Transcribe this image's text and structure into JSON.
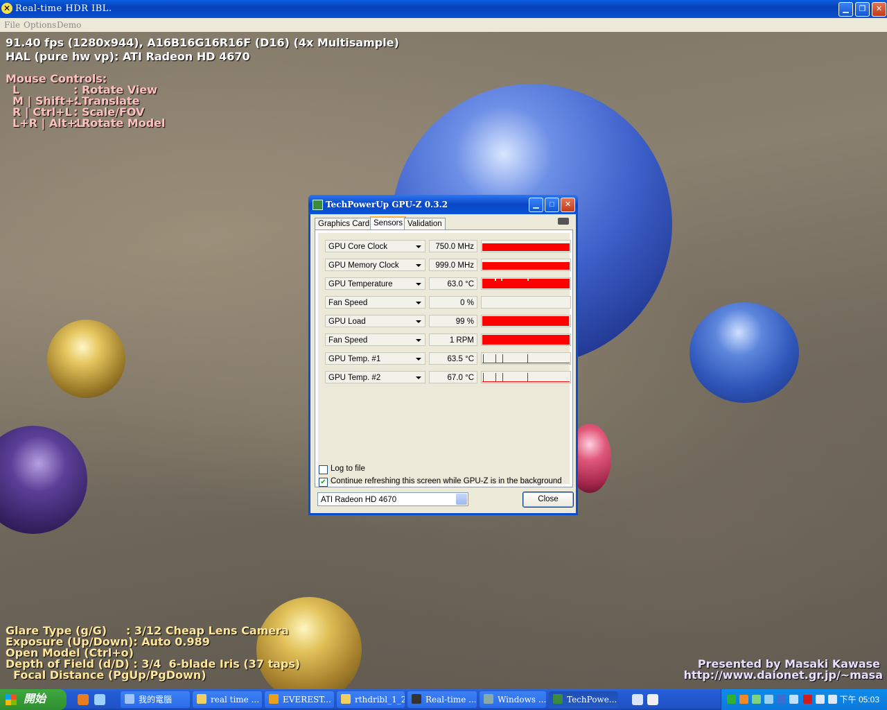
{
  "window": {
    "title": "Real-time HDR IBL."
  },
  "menu": [
    "File",
    "Options",
    "Demo"
  ],
  "hud": {
    "stats": [
      "91.40 fps (1280x944), A16B16G16R16F (D16) (4x Multisample)",
      "HAL (pure hw vp): ATI Radeon HD 4670"
    ],
    "mouse_controls_title": "Mouse Controls:",
    "mouse_controls": [
      {
        "keys": "L",
        "action": ": Rotate View"
      },
      {
        "keys": "M | Shift+L",
        "action": ": Translate"
      },
      {
        "keys": "R | Ctrl+L",
        "action": ": Scale/FOV"
      },
      {
        "keys": "L+R | Alt+L",
        "action": ": Rotate Model"
      }
    ],
    "bottom": [
      "Glare Type (g/G)     : 3/12 Cheap Lens Camera",
      "Exposure (Up/Down): Auto 0.989",
      "Open Model (Ctrl+o)",
      "Depth of Field (d/D) : 3/4  6-blade Iris (37 taps)",
      "  Focal Distance (PgUp/PgDown)"
    ],
    "credit": [
      "Presented by Masaki Kawase",
      "http://www.daionet.gr.jp/~masa"
    ]
  },
  "gpuz": {
    "title": "TechPowerUp GPU-Z 0.3.2",
    "tabs": [
      "Graphics Card",
      "Sensors",
      "Validation"
    ],
    "active_tab": "Sensors",
    "sensors": [
      {
        "name": "GPU Core Clock",
        "value": "750.0 MHz",
        "level": 1.0,
        "graph": "bar"
      },
      {
        "name": "GPU Memory Clock",
        "value": "999.0 MHz",
        "level": 1.0,
        "graph": "bar"
      },
      {
        "name": "GPU Temperature",
        "value": "63.0 °C",
        "level": 1.0,
        "graph": "bar-gaps"
      },
      {
        "name": "Fan Speed",
        "value": "0 %",
        "level": 0.0,
        "graph": "bar"
      },
      {
        "name": "GPU Load",
        "value": "99 %",
        "level": 0.99,
        "graph": "bar"
      },
      {
        "name": "Fan Speed",
        "value": "1 RPM",
        "level": 1.0,
        "graph": "bar"
      },
      {
        "name": "GPU Temp. #1",
        "value": "63.5 °C",
        "level": 0.1,
        "graph": "spikes"
      },
      {
        "name": "GPU Temp. #2",
        "value": "67.0 °C",
        "level": 0.1,
        "graph": "spikes"
      }
    ],
    "log_to_file": {
      "label": "Log to file",
      "checked": false
    },
    "continue_refresh": {
      "label": "Continue refreshing this screen while GPU-Z is in the background",
      "checked": true
    },
    "gpu_select": "ATI Radeon HD 4670",
    "close_label": "Close",
    "accent": "#ff0000"
  },
  "taskbar": {
    "start_label": "開始",
    "tasks": [
      "我的電腦",
      "real time ...",
      "EVEREST...",
      "rthdribl_1_2",
      "Real-time ...",
      "Windows ...",
      "TechPowe..."
    ],
    "clock": "下午 05:03"
  }
}
